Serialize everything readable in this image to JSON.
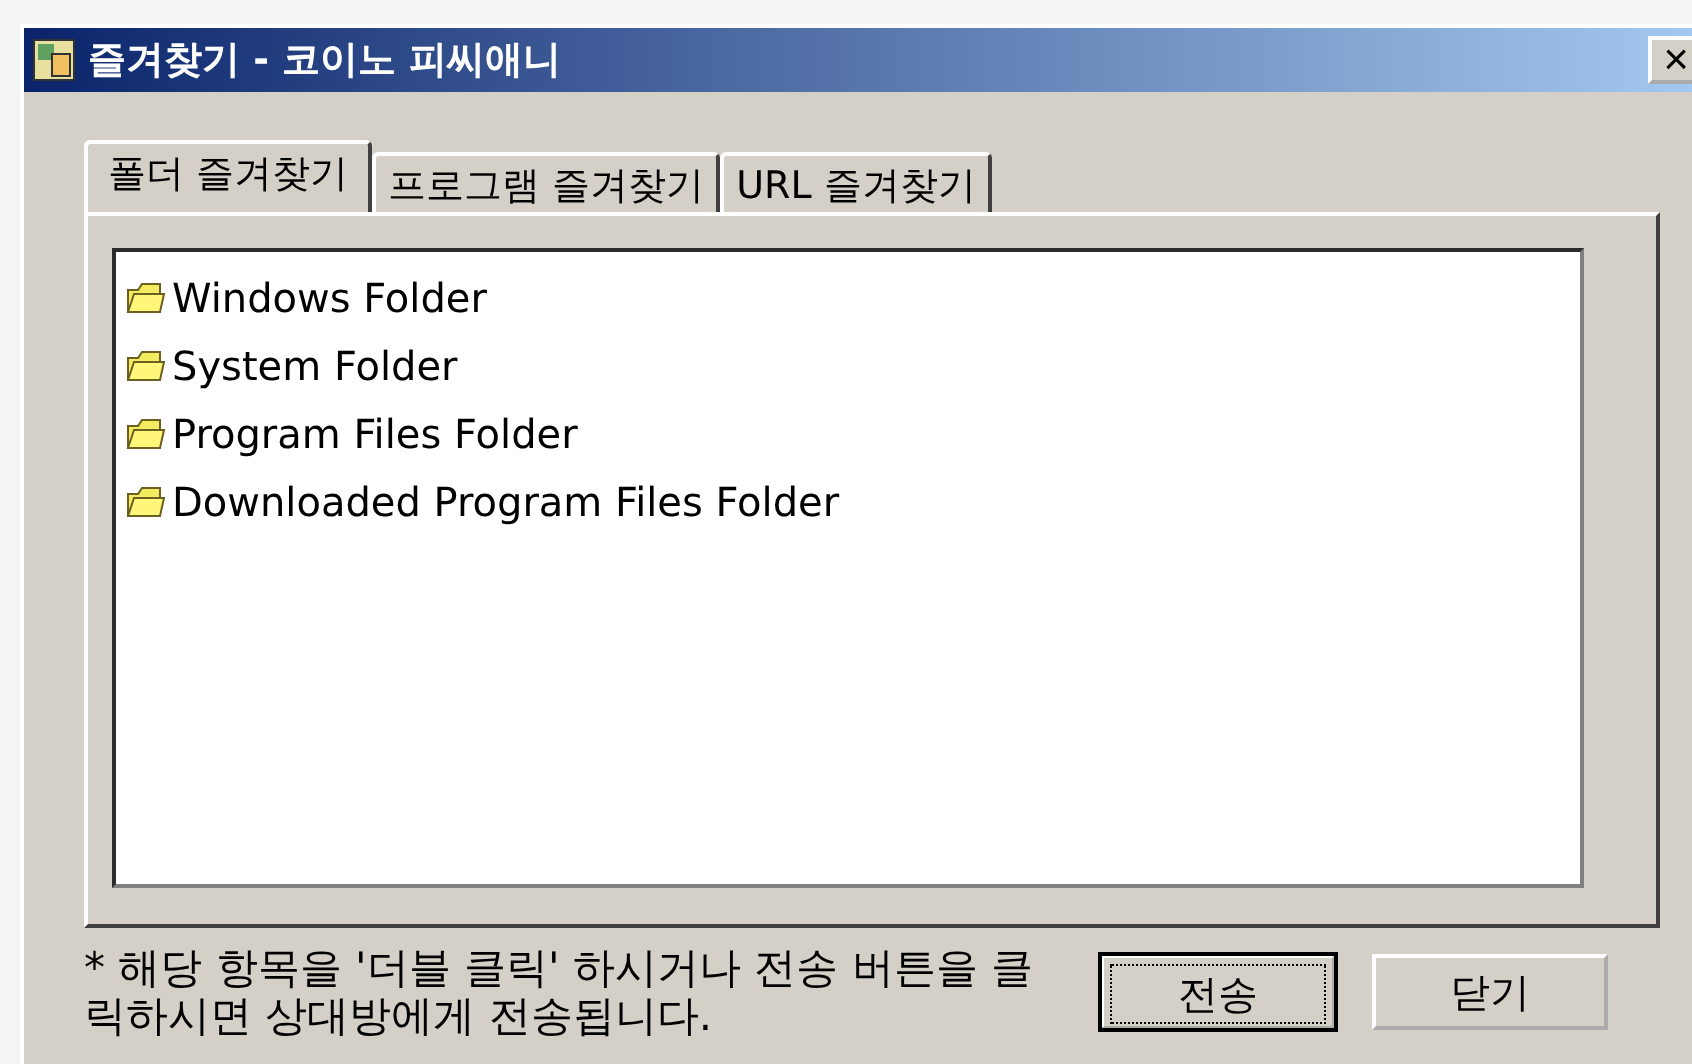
{
  "window": {
    "title": "즐겨찾기 - 코이노 피씨애니",
    "close": "×"
  },
  "tabs": [
    {
      "label": "폴더 즐겨찾기",
      "selected": true
    },
    {
      "label": "프로그램 즐겨찾기",
      "selected": false
    },
    {
      "label": "URL 즐겨찾기",
      "selected": false
    }
  ],
  "items": [
    {
      "label": "Windows Folder"
    },
    {
      "label": "System Folder"
    },
    {
      "label": "Program Files Folder"
    },
    {
      "label": "Downloaded Program Files Folder"
    }
  ],
  "hint": "* 해당 항목을 '더블 클릭' 하시거나 전송 버튼을 클릭하시면 상대방에게 전송됩니다.",
  "buttons": [
    {
      "label": "전송",
      "focused": true
    },
    {
      "label": "닫기",
      "focused": false
    }
  ]
}
